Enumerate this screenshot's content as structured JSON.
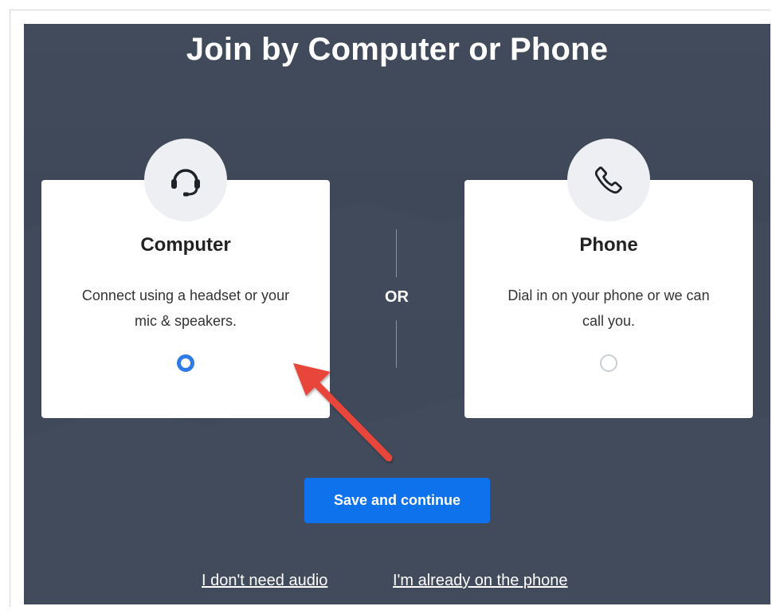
{
  "dialog": {
    "title": "Join by Computer or Phone",
    "separator": "OR"
  },
  "options": {
    "computer": {
      "icon": "headset-icon",
      "label": "Computer",
      "description": "Connect using a headset or your mic & speakers.",
      "selected": true
    },
    "phone": {
      "icon": "phone-icon",
      "label": "Phone",
      "description": "Dial in on your phone or we can call you.",
      "selected": false
    }
  },
  "actions": {
    "save_label": "Save and continue",
    "no_audio_label": "I don't need audio",
    "on_phone_label": "I'm already on the phone"
  },
  "annotation": {
    "arrow_color": "#e8443a"
  },
  "colors": {
    "panel_background": "#3d4656",
    "primary_button": "#0e72ed",
    "radio_selected": "#2f7be6"
  }
}
